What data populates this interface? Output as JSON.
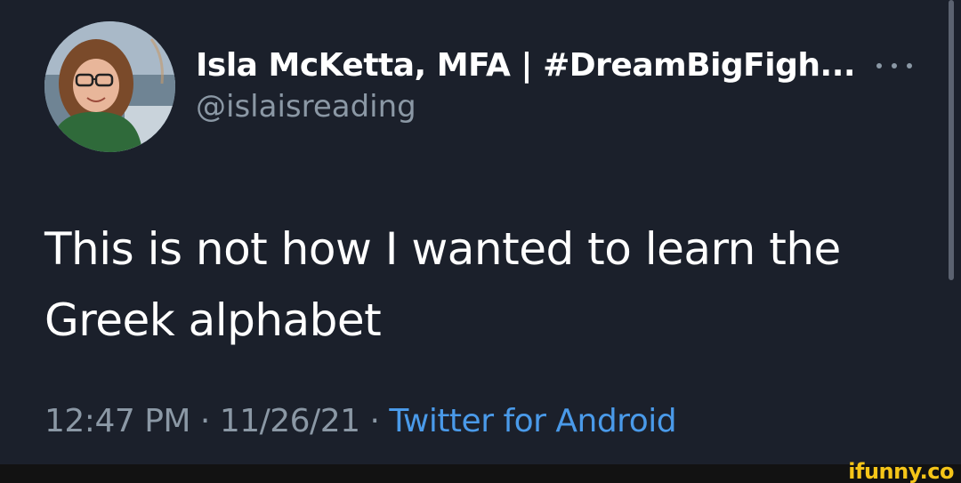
{
  "tweet": {
    "display_name": "Isla McKetta, MFA | #DreamBigFigh...",
    "handle": "@islaisreading",
    "more_icon": "more-horizontal-icon",
    "text": "This is not how I wanted to learn the Greek alphabet",
    "time": "12:47 PM",
    "separator": " · ",
    "date": "11/26/21",
    "source": "Twitter for Android"
  },
  "watermark": {
    "text": "ifunny.co"
  },
  "colors": {
    "background": "#1b202b",
    "text_primary": "#ffffff",
    "text_secondary": "#8b98a5",
    "link": "#4a9ae9",
    "watermark": "#f5c518"
  }
}
